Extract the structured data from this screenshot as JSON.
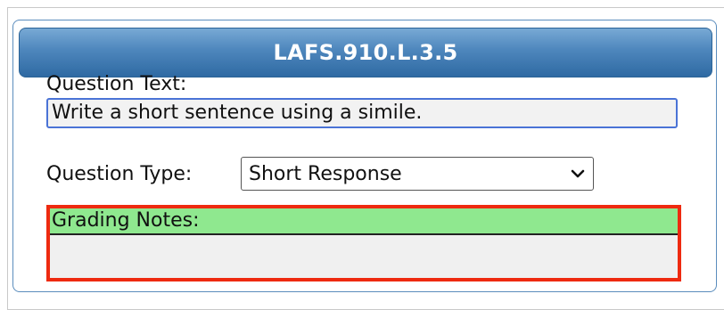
{
  "panel": {
    "title": "LAFS.910.L.3.5"
  },
  "question_text": {
    "label": "Question Text:",
    "value": "Write a short sentence using a simile."
  },
  "question_type": {
    "label": "Question Type:",
    "selected": "Short Response"
  },
  "grading_notes": {
    "label": "Grading Notes:",
    "value": ""
  },
  "colors": {
    "header_blue": "#4d86bc",
    "input_border_blue": "#4a73d6",
    "highlight_red": "#ee2a10",
    "label_green": "#8fe88f"
  },
  "icons": {
    "select_arrow": "chevron-down-icon"
  }
}
